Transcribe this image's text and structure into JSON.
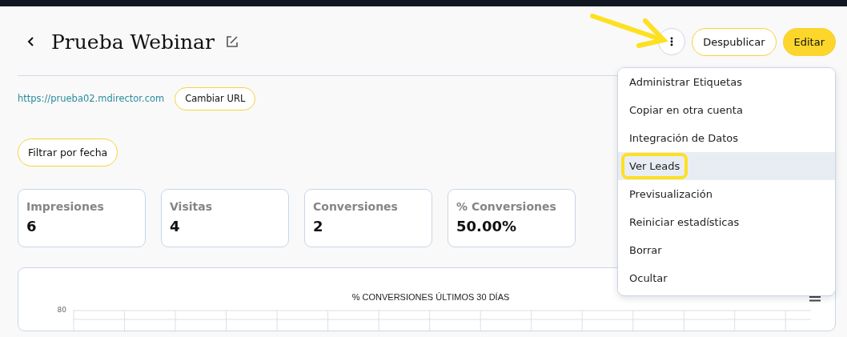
{
  "header": {
    "title": "Prueba Webinar",
    "buttons": [
      {
        "label": "Despublicar",
        "kind": "outline"
      },
      {
        "label": "Editar",
        "kind": "primary"
      }
    ]
  },
  "url": {
    "link": "https://prueba02.mdirector.com",
    "button": "Cambiar URL"
  },
  "filter_button": "Filtrar por fecha",
  "stats": [
    {
      "label": "Impresiones",
      "value": "6"
    },
    {
      "label": "Visitas",
      "value": "4"
    },
    {
      "label": "Conversiones",
      "value": "2"
    },
    {
      "label": "% Conversiones",
      "value": "50.00%"
    }
  ],
  "chart": {
    "title": "% CONVERSIONES ÚLTIMOS 30 DÍAS",
    "ytick": "80"
  },
  "menu": [
    {
      "label": "Administrar Etiquetas",
      "selected": false
    },
    {
      "label": "Copiar en otra cuenta",
      "selected": false
    },
    {
      "label": "Integración de Datos",
      "selected": false
    },
    {
      "label": "Ver Leads",
      "selected": true
    },
    {
      "label": "Previsualización",
      "selected": false
    },
    {
      "label": "Reiniciar estadísticas",
      "selected": false
    },
    {
      "label": "Borrar",
      "selected": false
    },
    {
      "label": "Ocultar",
      "selected": false
    }
  ]
}
